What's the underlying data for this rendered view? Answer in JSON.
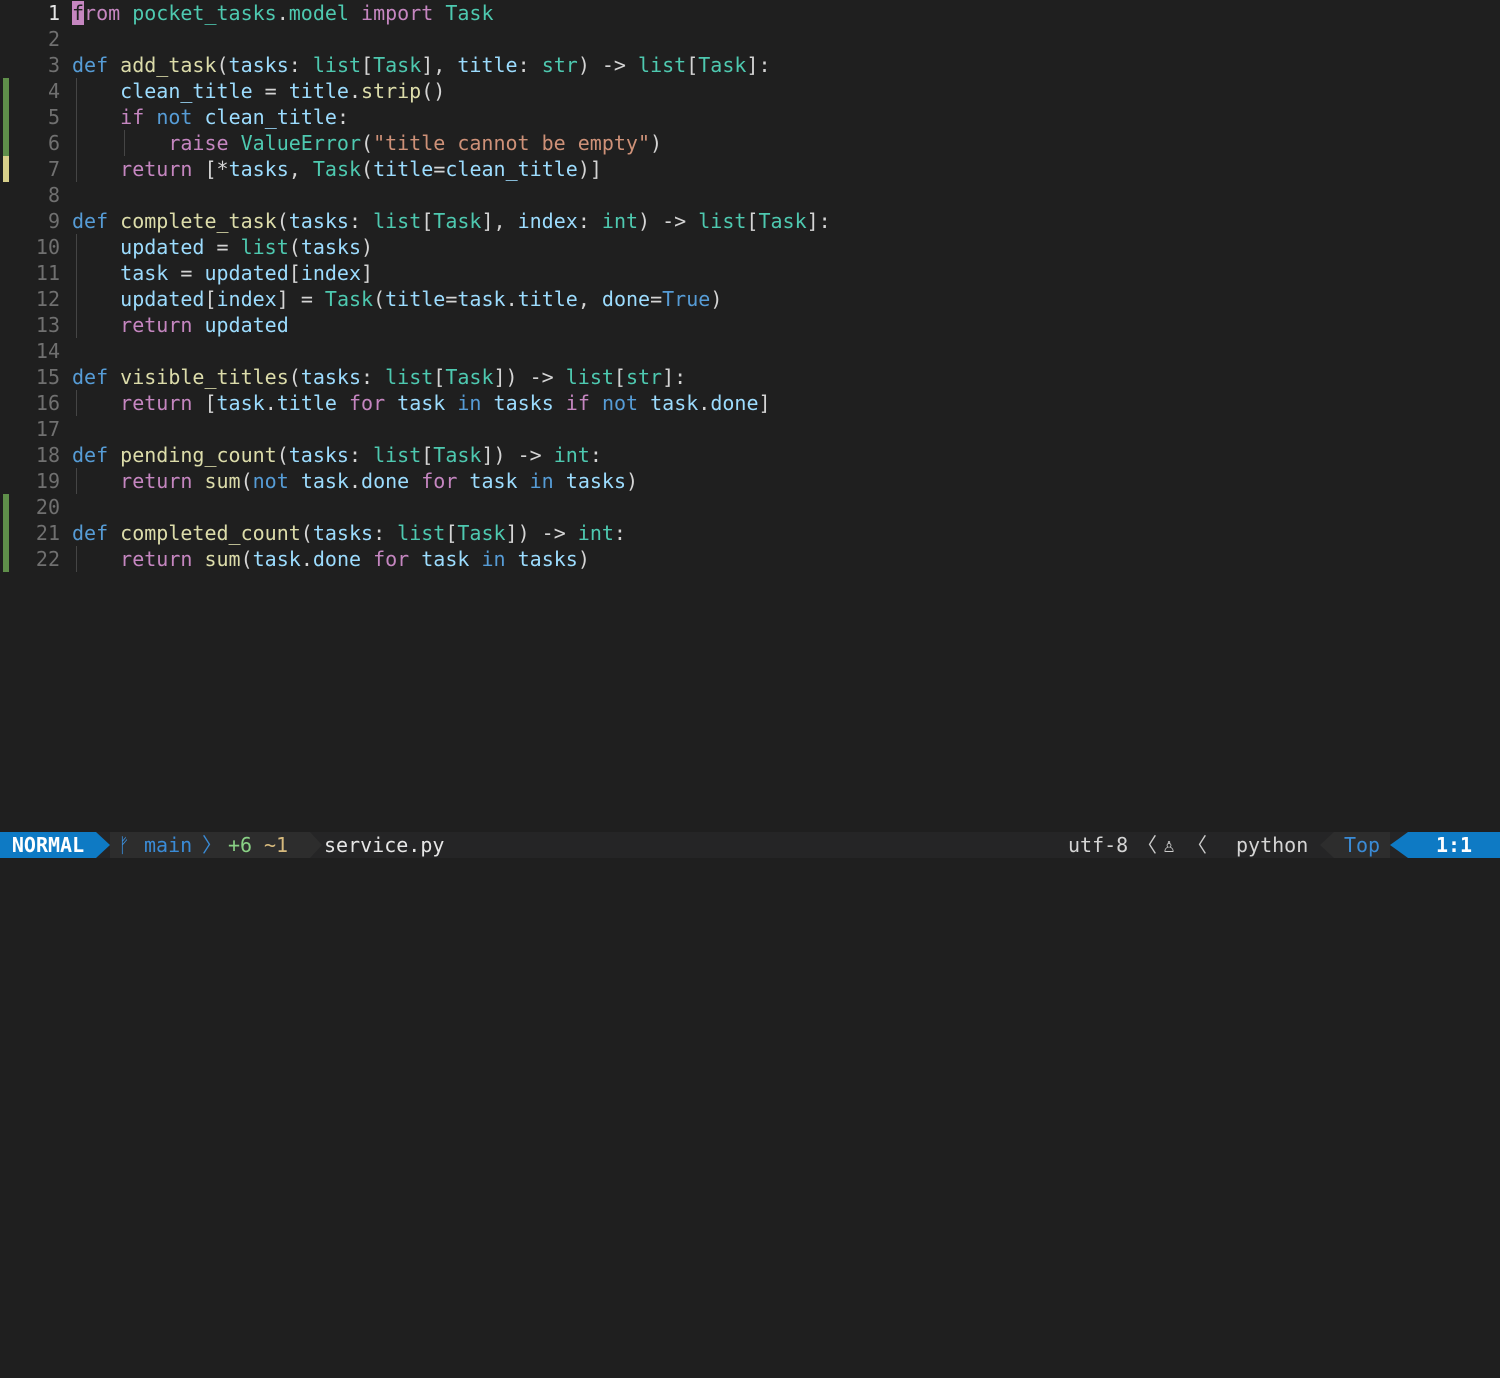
{
  "editor": {
    "lines": [
      {
        "num": "1",
        "sign": "",
        "indent": 0,
        "tokens": [
          [
            "from",
            "ctl"
          ],
          [
            " ",
            "pl"
          ],
          [
            "pocket_tasks",
            "ty"
          ],
          [
            ".",
            "pl"
          ],
          [
            "model",
            "ty"
          ],
          [
            " ",
            "pl"
          ],
          [
            "import",
            "ctl"
          ],
          [
            " ",
            "pl"
          ],
          [
            "Task",
            "ty"
          ]
        ]
      },
      {
        "num": "2",
        "sign": "",
        "indent": 0,
        "tokens": []
      },
      {
        "num": "3",
        "sign": "",
        "indent": 0,
        "tokens": [
          [
            "def",
            "kw"
          ],
          [
            " ",
            "pl"
          ],
          [
            "add_task",
            "fn"
          ],
          [
            "(",
            "pl"
          ],
          [
            "tasks",
            "var"
          ],
          [
            ": ",
            "pl"
          ],
          [
            "list",
            "ty"
          ],
          [
            "[",
            "pl"
          ],
          [
            "Task",
            "ty"
          ],
          [
            "], ",
            "pl"
          ],
          [
            "title",
            "var"
          ],
          [
            ": ",
            "pl"
          ],
          [
            "str",
            "ty"
          ],
          [
            ") -> ",
            "pl"
          ],
          [
            "list",
            "ty"
          ],
          [
            "[",
            "pl"
          ],
          [
            "Task",
            "ty"
          ],
          [
            "]:",
            "pl"
          ]
        ]
      },
      {
        "num": "4",
        "sign": "add",
        "indent": 1,
        "tokens": [
          [
            "    ",
            "pl"
          ],
          [
            "clean_title",
            "var"
          ],
          [
            " = ",
            "pl"
          ],
          [
            "title",
            "var"
          ],
          [
            ".",
            "pl"
          ],
          [
            "strip",
            "fn"
          ],
          [
            "()",
            "pl"
          ]
        ]
      },
      {
        "num": "5",
        "sign": "add",
        "indent": 1,
        "tokens": [
          [
            "    ",
            "pl"
          ],
          [
            "if",
            "ctl"
          ],
          [
            " ",
            "pl"
          ],
          [
            "not",
            "kw"
          ],
          [
            " ",
            "pl"
          ],
          [
            "clean_title",
            "var"
          ],
          [
            ":",
            "pl"
          ]
        ]
      },
      {
        "num": "6",
        "sign": "add",
        "indent": 2,
        "tokens": [
          [
            "        ",
            "pl"
          ],
          [
            "raise",
            "ctl"
          ],
          [
            " ",
            "pl"
          ],
          [
            "ValueError",
            "ty"
          ],
          [
            "(",
            "pl"
          ],
          [
            "\"title cannot be empty\"",
            "str"
          ],
          [
            ")",
            "pl"
          ]
        ]
      },
      {
        "num": "7",
        "sign": "change",
        "indent": 1,
        "tokens": [
          [
            "    ",
            "pl"
          ],
          [
            "return",
            "ctl"
          ],
          [
            " [",
            "pl"
          ],
          [
            "*",
            "pl"
          ],
          [
            "tasks",
            "var"
          ],
          [
            ", ",
            "pl"
          ],
          [
            "Task",
            "ty"
          ],
          [
            "(",
            "pl"
          ],
          [
            "title",
            "var"
          ],
          [
            "=",
            "pl"
          ],
          [
            "clean_title",
            "var"
          ],
          [
            ")]",
            "pl"
          ]
        ]
      },
      {
        "num": "8",
        "sign": "",
        "indent": 0,
        "tokens": []
      },
      {
        "num": "9",
        "sign": "",
        "indent": 0,
        "tokens": [
          [
            "def",
            "kw"
          ],
          [
            " ",
            "pl"
          ],
          [
            "complete_task",
            "fn"
          ],
          [
            "(",
            "pl"
          ],
          [
            "tasks",
            "var"
          ],
          [
            ": ",
            "pl"
          ],
          [
            "list",
            "ty"
          ],
          [
            "[",
            "pl"
          ],
          [
            "Task",
            "ty"
          ],
          [
            "], ",
            "pl"
          ],
          [
            "index",
            "var"
          ],
          [
            ": ",
            "pl"
          ],
          [
            "int",
            "ty"
          ],
          [
            ") -> ",
            "pl"
          ],
          [
            "list",
            "ty"
          ],
          [
            "[",
            "pl"
          ],
          [
            "Task",
            "ty"
          ],
          [
            "]:",
            "pl"
          ]
        ]
      },
      {
        "num": "10",
        "sign": "",
        "indent": 1,
        "tokens": [
          [
            "    ",
            "pl"
          ],
          [
            "updated",
            "var"
          ],
          [
            " = ",
            "pl"
          ],
          [
            "list",
            "ty"
          ],
          [
            "(",
            "pl"
          ],
          [
            "tasks",
            "var"
          ],
          [
            ")",
            "pl"
          ]
        ]
      },
      {
        "num": "11",
        "sign": "",
        "indent": 1,
        "tokens": [
          [
            "    ",
            "pl"
          ],
          [
            "task",
            "var"
          ],
          [
            " = ",
            "pl"
          ],
          [
            "updated",
            "var"
          ],
          [
            "[",
            "pl"
          ],
          [
            "index",
            "var"
          ],
          [
            "]",
            "pl"
          ]
        ]
      },
      {
        "num": "12",
        "sign": "",
        "indent": 1,
        "tokens": [
          [
            "    ",
            "pl"
          ],
          [
            "updated",
            "var"
          ],
          [
            "[",
            "pl"
          ],
          [
            "index",
            "var"
          ],
          [
            "] = ",
            "pl"
          ],
          [
            "Task",
            "ty"
          ],
          [
            "(",
            "pl"
          ],
          [
            "title",
            "var"
          ],
          [
            "=",
            "pl"
          ],
          [
            "task",
            "var"
          ],
          [
            ".",
            "pl"
          ],
          [
            "title",
            "var"
          ],
          [
            ", ",
            "pl"
          ],
          [
            "done",
            "var"
          ],
          [
            "=",
            "pl"
          ],
          [
            "True",
            "const"
          ],
          [
            ")",
            "pl"
          ]
        ]
      },
      {
        "num": "13",
        "sign": "",
        "indent": 1,
        "tokens": [
          [
            "    ",
            "pl"
          ],
          [
            "return",
            "ctl"
          ],
          [
            " ",
            "pl"
          ],
          [
            "updated",
            "var"
          ]
        ]
      },
      {
        "num": "14",
        "sign": "",
        "indent": 0,
        "tokens": []
      },
      {
        "num": "15",
        "sign": "",
        "indent": 0,
        "tokens": [
          [
            "def",
            "kw"
          ],
          [
            " ",
            "pl"
          ],
          [
            "visible_titles",
            "fn"
          ],
          [
            "(",
            "pl"
          ],
          [
            "tasks",
            "var"
          ],
          [
            ": ",
            "pl"
          ],
          [
            "list",
            "ty"
          ],
          [
            "[",
            "pl"
          ],
          [
            "Task",
            "ty"
          ],
          [
            "]) -> ",
            "pl"
          ],
          [
            "list",
            "ty"
          ],
          [
            "[",
            "pl"
          ],
          [
            "str",
            "ty"
          ],
          [
            "]:",
            "pl"
          ]
        ]
      },
      {
        "num": "16",
        "sign": "",
        "indent": 1,
        "tokens": [
          [
            "    ",
            "pl"
          ],
          [
            "return",
            "ctl"
          ],
          [
            " [",
            "pl"
          ],
          [
            "task",
            "var"
          ],
          [
            ".",
            "pl"
          ],
          [
            "title",
            "var"
          ],
          [
            " ",
            "pl"
          ],
          [
            "for",
            "ctl"
          ],
          [
            " ",
            "pl"
          ],
          [
            "task",
            "var"
          ],
          [
            " ",
            "pl"
          ],
          [
            "in",
            "kw"
          ],
          [
            " ",
            "pl"
          ],
          [
            "tasks",
            "var"
          ],
          [
            " ",
            "pl"
          ],
          [
            "if",
            "ctl"
          ],
          [
            " ",
            "pl"
          ],
          [
            "not",
            "kw"
          ],
          [
            " ",
            "pl"
          ],
          [
            "task",
            "var"
          ],
          [
            ".",
            "pl"
          ],
          [
            "done",
            "var"
          ],
          [
            "]",
            "pl"
          ]
        ]
      },
      {
        "num": "17",
        "sign": "",
        "indent": 0,
        "tokens": []
      },
      {
        "num": "18",
        "sign": "",
        "indent": 0,
        "tokens": [
          [
            "def",
            "kw"
          ],
          [
            " ",
            "pl"
          ],
          [
            "pending_count",
            "fn"
          ],
          [
            "(",
            "pl"
          ],
          [
            "tasks",
            "var"
          ],
          [
            ": ",
            "pl"
          ],
          [
            "list",
            "ty"
          ],
          [
            "[",
            "pl"
          ],
          [
            "Task",
            "ty"
          ],
          [
            "]) -> ",
            "pl"
          ],
          [
            "int",
            "ty"
          ],
          [
            ":",
            "pl"
          ]
        ]
      },
      {
        "num": "19",
        "sign": "",
        "indent": 1,
        "tokens": [
          [
            "    ",
            "pl"
          ],
          [
            "return",
            "ctl"
          ],
          [
            " ",
            "pl"
          ],
          [
            "sum",
            "fn"
          ],
          [
            "(",
            "pl"
          ],
          [
            "not",
            "kw"
          ],
          [
            " ",
            "pl"
          ],
          [
            "task",
            "var"
          ],
          [
            ".",
            "pl"
          ],
          [
            "done",
            "var"
          ],
          [
            " ",
            "pl"
          ],
          [
            "for",
            "ctl"
          ],
          [
            " ",
            "pl"
          ],
          [
            "task",
            "var"
          ],
          [
            " ",
            "pl"
          ],
          [
            "in",
            "kw"
          ],
          [
            " ",
            "pl"
          ],
          [
            "tasks",
            "var"
          ],
          [
            ")",
            "pl"
          ]
        ]
      },
      {
        "num": "20",
        "sign": "add",
        "indent": 0,
        "tokens": []
      },
      {
        "num": "21",
        "sign": "add",
        "indent": 0,
        "tokens": [
          [
            "def",
            "kw"
          ],
          [
            " ",
            "pl"
          ],
          [
            "completed_count",
            "fn"
          ],
          [
            "(",
            "pl"
          ],
          [
            "tasks",
            "var"
          ],
          [
            ": ",
            "pl"
          ],
          [
            "list",
            "ty"
          ],
          [
            "[",
            "pl"
          ],
          [
            "Task",
            "ty"
          ],
          [
            "]) -> ",
            "pl"
          ],
          [
            "int",
            "ty"
          ],
          [
            ":",
            "pl"
          ]
        ]
      },
      {
        "num": "22",
        "sign": "add",
        "indent": 1,
        "tokens": [
          [
            "    ",
            "pl"
          ],
          [
            "return",
            "ctl"
          ],
          [
            " ",
            "pl"
          ],
          [
            "sum",
            "fn"
          ],
          [
            "(",
            "pl"
          ],
          [
            "task",
            "var"
          ],
          [
            ".",
            "pl"
          ],
          [
            "done",
            "var"
          ],
          [
            " ",
            "pl"
          ],
          [
            "for",
            "ctl"
          ],
          [
            " ",
            "pl"
          ],
          [
            "task",
            "var"
          ],
          [
            " ",
            "pl"
          ],
          [
            "in",
            "kw"
          ],
          [
            " ",
            "pl"
          ],
          [
            "tasks",
            "var"
          ],
          [
            ")",
            "pl"
          ]
        ]
      }
    ]
  },
  "statusline": {
    "mode": "NORMAL",
    "branch_icon": "ᚠ",
    "branch": "main",
    "separator": "〉",
    "diff_added": "+6",
    "diff_changed": "~1",
    "filename": "service.py",
    "encoding": "utf-8",
    "left_separator": "〈",
    "os_icon": "linux-tux-icon",
    "os_glyph": "♙",
    "filetype_icon": "python-icon",
    "filetype": "python",
    "position": "Top",
    "location": "1:1"
  },
  "colors": {
    "background": "#1f1f1f",
    "accent": "#0e7ac4",
    "diff_add": "#5f8f4a",
    "diff_change": "#d7cf8a"
  }
}
